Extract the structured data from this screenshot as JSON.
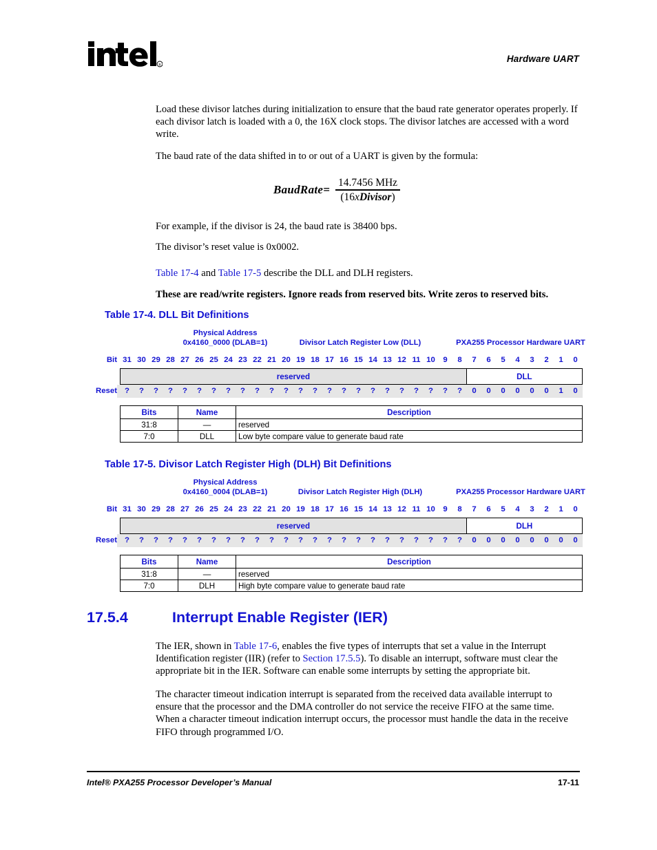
{
  "header": {
    "running_head": "Hardware UART",
    "logo_text": "intel",
    "logo_mark": "registered-trademark"
  },
  "paragraphs": {
    "p1": "Load these divisor latches during initialization to ensure that the baud rate generator operates properly. If each divisor latch is loaded with a 0, the 16X clock stops. The divisor latches are accessed with a word write.",
    "p2": "The baud rate of the data shifted in to or out of a UART is given by the formula:",
    "p3": "For example, if the divisor is 24, the baud rate is 38400 bps.",
    "p4": "The divisor’s reset value is 0x0002.",
    "p5_pre": "",
    "p5_link1": "Table 17-4",
    "p5_mid": " and ",
    "p5_link2": "Table 17-5",
    "p5_post": " describe the DLL and DLH registers.",
    "p6_bold": "These are read/write registers. Ignore reads from reserved bits. Write zeros to reserved bits.",
    "ier_p1_a": "The IER, shown in ",
    "ier_p1_link1": "Table 17-6",
    "ier_p1_b": ", enables the five types of interrupts that set a value in the Interrupt Identification register (IIR) (refer to ",
    "ier_p1_link2": "Section 17.5.5",
    "ier_p1_c": "). To disable an interrupt, software must clear the appropriate bit in the IER. Software can enable some interrupts by setting the appropriate bit.",
    "ier_p2": "The character timeout indication interrupt is separated from the received data available interrupt to ensure that the processor and the DMA controller do not service the receive FIFO at the same time. When a character timeout indication interrupt occurs, the processor must handle the data in the receive FIFO through programmed I/O."
  },
  "formula": {
    "lhs": "BaudRate",
    "equals": "=",
    "numerator": "14.7456 MHz",
    "denominator_open": "(",
    "denominator_16": "16",
    "denominator_x": "x",
    "denominator_var": "Divisor",
    "denominator_close": ")"
  },
  "table_17_4": {
    "caption": "Table 17-4. DLL Bit Definitions",
    "physical_address_label": "Physical Address",
    "physical_address_value": "0x4160_0000 (DLAB=1)",
    "register_name": "Divisor Latch Register Low (DLL)",
    "processor": "PXA255 Processor Hardware UART",
    "bit_label": "Bit",
    "reset_label": "Reset",
    "bits": [
      "31",
      "30",
      "29",
      "28",
      "27",
      "26",
      "25",
      "24",
      "23",
      "22",
      "21",
      "20",
      "19",
      "18",
      "17",
      "16",
      "15",
      "14",
      "13",
      "12",
      "11",
      "10",
      "9",
      "8",
      "7",
      "6",
      "5",
      "4",
      "3",
      "2",
      "1",
      "0"
    ],
    "fields": [
      {
        "name": "reserved",
        "span": 24,
        "style": "reserved"
      },
      {
        "name": "DLL",
        "span": 8,
        "style": "white"
      }
    ],
    "reset_values": [
      "?",
      "?",
      "?",
      "?",
      "?",
      "?",
      "?",
      "?",
      "?",
      "?",
      "?",
      "?",
      "?",
      "?",
      "?",
      "?",
      "?",
      "?",
      "?",
      "?",
      "?",
      "?",
      "?",
      "?",
      "0",
      "0",
      "0",
      "0",
      "0",
      "0",
      "1",
      "0"
    ],
    "desc_headers": [
      "Bits",
      "Name",
      "Description"
    ],
    "desc_rows": [
      {
        "bits": "31:8",
        "name": "—",
        "description": "reserved"
      },
      {
        "bits": "7:0",
        "name": "DLL",
        "description": "Low byte compare value to generate baud rate"
      }
    ]
  },
  "table_17_5": {
    "caption": "Table 17-5. Divisor Latch Register High (DLH) Bit Definitions",
    "physical_address_label": "Physical Address",
    "physical_address_value": "0x4160_0004 (DLAB=1)",
    "register_name": "Divisor Latch Register High (DLH)",
    "processor": "PXA255 Processor Hardware UART",
    "bit_label": "Bit",
    "reset_label": "Reset",
    "bits": [
      "31",
      "30",
      "29",
      "28",
      "27",
      "26",
      "25",
      "24",
      "23",
      "22",
      "21",
      "20",
      "19",
      "18",
      "17",
      "16",
      "15",
      "14",
      "13",
      "12",
      "11",
      "10",
      "9",
      "8",
      "7",
      "6",
      "5",
      "4",
      "3",
      "2",
      "1",
      "0"
    ],
    "fields": [
      {
        "name": "reserved",
        "span": 24,
        "style": "reserved"
      },
      {
        "name": "DLH",
        "span": 8,
        "style": "white"
      }
    ],
    "reset_values": [
      "?",
      "?",
      "?",
      "?",
      "?",
      "?",
      "?",
      "?",
      "?",
      "?",
      "?",
      "?",
      "?",
      "?",
      "?",
      "?",
      "?",
      "?",
      "?",
      "?",
      "?",
      "?",
      "?",
      "?",
      "0",
      "0",
      "0",
      "0",
      "0",
      "0",
      "0",
      "0"
    ],
    "desc_headers": [
      "Bits",
      "Name",
      "Description"
    ],
    "desc_rows": [
      {
        "bits": "31:8",
        "name": "—",
        "description": "reserved"
      },
      {
        "bits": "7:0",
        "name": "DLH",
        "description": "High byte compare value to generate baud rate"
      }
    ]
  },
  "section": {
    "number": "17.5.4",
    "title": "Interrupt Enable Register (IER)"
  },
  "footer": {
    "left": "Intel® PXA255 Processor Developer’s Manual",
    "page": "17-11"
  },
  "colors": {
    "link_blue": "#1414d2",
    "reserved_gray": "#e2e2e2",
    "reset_band_gray": "#e6e6e6"
  }
}
